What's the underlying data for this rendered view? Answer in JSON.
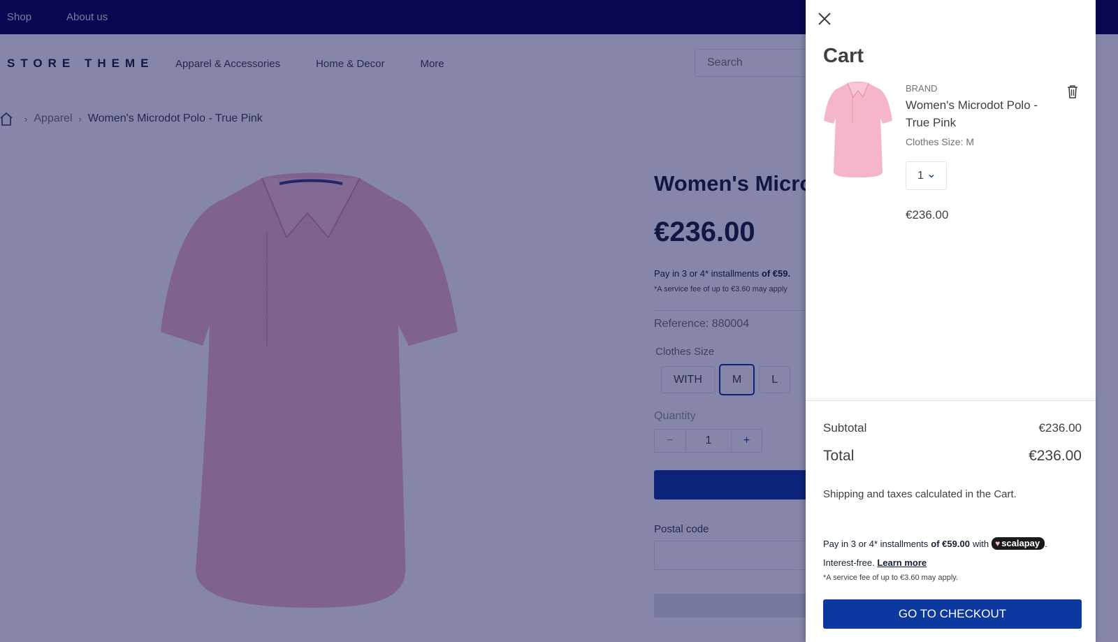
{
  "topbar": {
    "links": [
      "Shop",
      "About us"
    ]
  },
  "header": {
    "logo": "STORE THEME",
    "nav": [
      "Apparel & Accessories",
      "Home & Decor",
      "More"
    ],
    "search_placeholder": "Search"
  },
  "breadcrumb": {
    "category": "Apparel",
    "current": "Women's Microdot Polo - True Pink"
  },
  "product": {
    "title": "Women's Microdot Polo - True Pink",
    "price": "€236.00",
    "installments_text": "Pay in 3 or 4* installments",
    "installments_amount": "of €59.",
    "service_fee": "*A service fee of up to €3.60 may apply",
    "reference": "Reference: 880004",
    "size_label": "Clothes Size",
    "sizes": [
      "WITH",
      "M",
      "L"
    ],
    "selected_size": "M",
    "quantity_label": "Quantity",
    "quantity": "1",
    "postal_label": "Postal code"
  },
  "cart": {
    "title": "Cart",
    "items": [
      {
        "brand": "BRAND",
        "name": "Women's Microdot Polo - True Pink",
        "variant": "Clothes Size: M",
        "quantity": "1",
        "price": "€236.00"
      }
    ],
    "subtotal_label": "Subtotal",
    "subtotal": "€236.00",
    "total_label": "Total",
    "total": "€236.00",
    "shipping_note": "Shipping and taxes calculated in the Cart.",
    "scalapay": {
      "prefix": "Pay in 3 or 4* installments",
      "amount": "of €59.00",
      "with": "with",
      "brand": "scalapay",
      "interest": "Interest-free.",
      "learn_more": "Learn more",
      "fee": "*A service fee of up to €3.60 may apply."
    },
    "checkout_label": "GO TO CHECKOUT"
  },
  "colors": {
    "brand_navy": "#00034c",
    "primary_blue": "#0c389f",
    "overlay": "rgba(12,14,85,0.5)"
  }
}
